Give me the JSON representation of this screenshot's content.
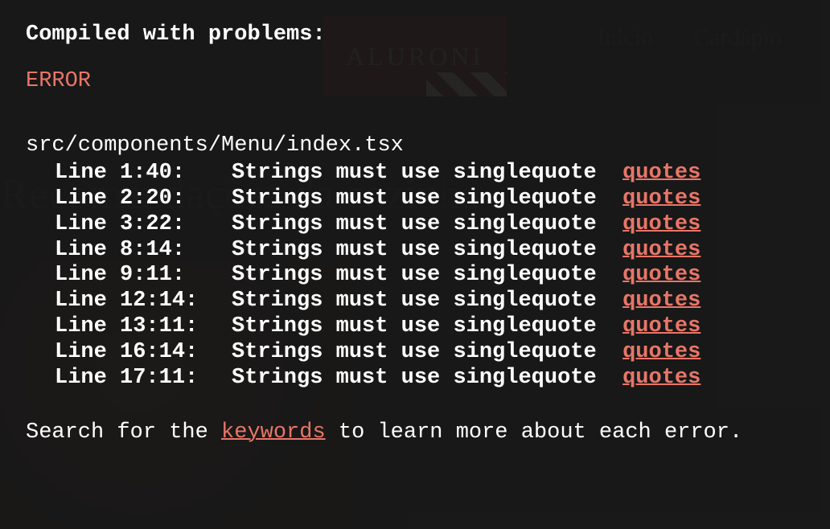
{
  "background": {
    "logo": "ALURONI",
    "nav": {
      "home": "Início",
      "menu": "Cardápio"
    },
    "hero_title": "Recomendações da cozinha"
  },
  "overlay": {
    "title": "Compiled with problems:",
    "label": "ERROR",
    "file": "src/components/Menu/index.tsx",
    "errors": [
      {
        "loc": "Line 1:40:  ",
        "msg": "Strings must use singlequote  ",
        "link": "quotes"
      },
      {
        "loc": "Line 2:20:  ",
        "msg": "Strings must use singlequote  ",
        "link": "quotes"
      },
      {
        "loc": "Line 3:22:  ",
        "msg": "Strings must use singlequote  ",
        "link": "quotes"
      },
      {
        "loc": "Line 8:14:  ",
        "msg": "Strings must use singlequote  ",
        "link": "quotes"
      },
      {
        "loc": "Line 9:11:  ",
        "msg": "Strings must use singlequote  ",
        "link": "quotes"
      },
      {
        "loc": "Line 12:14: ",
        "msg": "Strings must use singlequote  ",
        "link": "quotes"
      },
      {
        "loc": "Line 13:11: ",
        "msg": "Strings must use singlequote  ",
        "link": "quotes"
      },
      {
        "loc": "Line 16:14: ",
        "msg": "Strings must use singlequote  ",
        "link": "quotes"
      },
      {
        "loc": "Line 17:11: ",
        "msg": "Strings must use singlequote  ",
        "link": "quotes"
      }
    ],
    "footer_prefix": "Search for the ",
    "footer_link": "keywords",
    "footer_suffix": " to learn more about each error."
  }
}
